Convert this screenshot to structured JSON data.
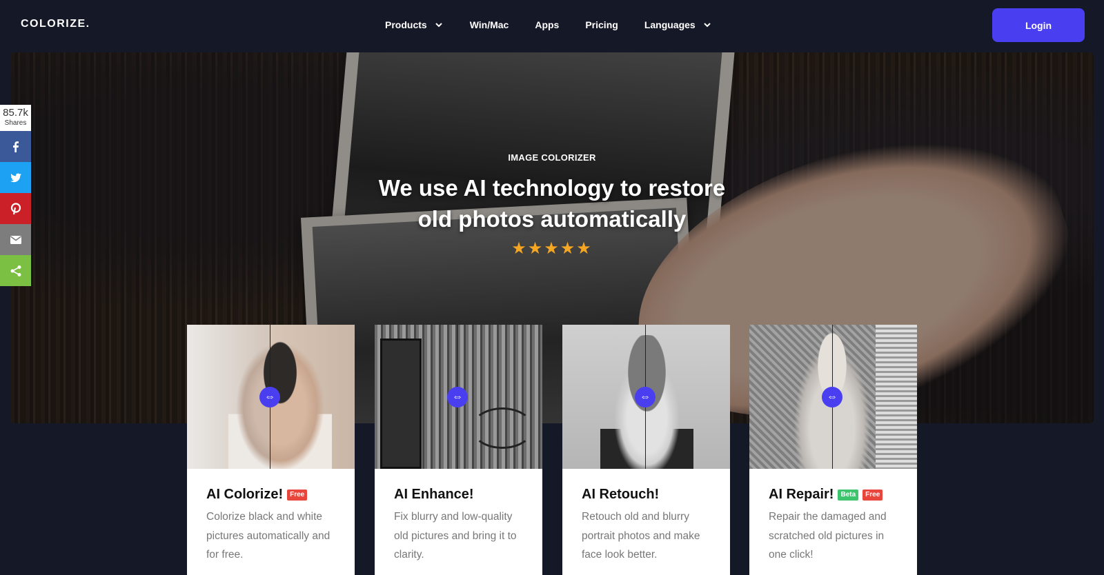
{
  "nav": {
    "logo": "COLORIZE.",
    "items": [
      {
        "label": "Products",
        "dropdown": true
      },
      {
        "label": "Win/Mac",
        "dropdown": false
      },
      {
        "label": "Apps",
        "dropdown": false
      },
      {
        "label": "Pricing",
        "dropdown": false
      },
      {
        "label": "Languages",
        "dropdown": true
      }
    ],
    "login": "Login"
  },
  "hero": {
    "kicker": "IMAGE COLORIZER",
    "title_line1": "We use AI technology to restore",
    "title_line2": "old photos automatically",
    "stars": "★★★★★",
    "rating_stars": 5
  },
  "share": {
    "count": "85.7k",
    "count_label": "Shares",
    "buttons": [
      {
        "network": "facebook",
        "icon": "facebook-icon",
        "color": "#3b5998"
      },
      {
        "network": "twitter",
        "icon": "twitter-icon",
        "color": "#1da1f2"
      },
      {
        "network": "pinterest",
        "icon": "pinterest-icon",
        "color": "#cb2027"
      },
      {
        "network": "email",
        "icon": "email-icon",
        "color": "#7d7d7d"
      },
      {
        "network": "share",
        "icon": "share-icon",
        "color": "#7bc043"
      }
    ]
  },
  "cards": [
    {
      "title": "AI Colorize!",
      "badges": [
        "Free"
      ],
      "desc": "Colorize black and white pictures automatically and for free."
    },
    {
      "title": "AI Enhance!",
      "badges": [],
      "desc": "Fix blurry and low-quality old pictures and bring it to clarity."
    },
    {
      "title": "AI Retouch!",
      "badges": [],
      "desc": "Retouch old and blurry portrait photos and make face look better."
    },
    {
      "title": "AI Repair!",
      "badges": [
        "Beta",
        "Free"
      ],
      "desc": "Repair the damaged and scratched old pictures in one click!"
    }
  ],
  "colors": {
    "accent": "#4a3ff0",
    "background": "#151827",
    "star": "#f5a623"
  }
}
